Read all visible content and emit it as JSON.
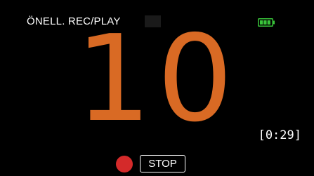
{
  "header": {
    "mode_label": "ÖNELL. REC/PLAY"
  },
  "battery": {
    "icon": "battery-full-icon",
    "color": "#39c43a"
  },
  "countdown": {
    "value": "10",
    "color": "#d96a24"
  },
  "remaining_time": "[0:29]",
  "controls": {
    "record_icon": "record-dot-icon",
    "record_color": "#d42a2a",
    "stop_label": "STOP"
  }
}
